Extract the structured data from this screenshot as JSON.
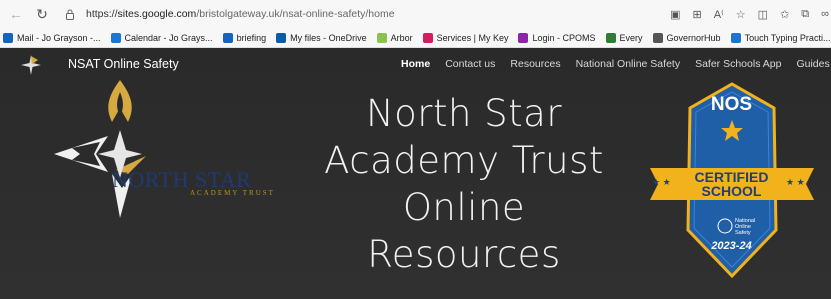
{
  "browser": {
    "url_prefix": "https://",
    "url_host": "sites.google.com",
    "url_path": "/bristolgateway.uk/nsat-online-safety/home",
    "bookmarks": [
      {
        "label": "Mail - Jo Grayson -...",
        "color": "#1565c0",
        "icon": "outlook-icon"
      },
      {
        "label": "Calendar - Jo Grays...",
        "color": "#1976d2",
        "icon": "calendar-icon"
      },
      {
        "label": "briefing",
        "color": "#1565c0",
        "icon": "briefing-icon"
      },
      {
        "label": "My files - OneDrive",
        "color": "#0b5cab",
        "icon": "onedrive-icon"
      },
      {
        "label": "Arbor",
        "color": "#8bc34a",
        "icon": "arbor-icon"
      },
      {
        "label": "Services | My Key",
        "color": "#d81b60",
        "icon": "mykey-icon"
      },
      {
        "label": "Login - CPOMS",
        "color": "#8e24aa",
        "icon": "cpoms-icon"
      },
      {
        "label": "Every",
        "color": "#2e7d32",
        "icon": "every-icon"
      },
      {
        "label": "GovernorHub",
        "color": "#555555",
        "icon": "governorhub-icon"
      },
      {
        "label": "Touch Typing Practi...",
        "color": "#1976d2",
        "icon": "touch-typing-icon"
      }
    ]
  },
  "site": {
    "title": "NSAT Online Safety",
    "menu": [
      "Home",
      "Contact us",
      "Resources",
      "National Online Safety",
      "Safer Schools App",
      "Guides"
    ],
    "active_menu": "Home",
    "hero_lines": [
      "North Star",
      "Academy Trust",
      "Online",
      "Resources"
    ],
    "logo_name": "NORTH STAR",
    "logo_sub": "ACADEMY TRUST",
    "badge": {
      "top": "NOS",
      "line1": "CERTIFIED",
      "line2": "SCHOOL",
      "small": [
        "National",
        "Online",
        "Safety"
      ],
      "year": "2023-24"
    }
  },
  "colors": {
    "background": "#2b2b2b",
    "trust_blue": "#1e3a73",
    "trust_gold": "#b8912e",
    "badge_blue": "#1f5fa8",
    "badge_gold": "#f2b21b"
  }
}
